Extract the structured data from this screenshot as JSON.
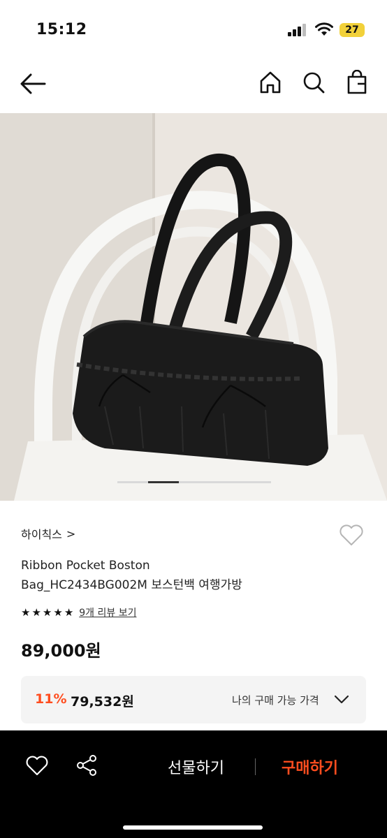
{
  "status_bar": {
    "time": "15:12",
    "battery": "27"
  },
  "nav": {
    "icons": [
      "back-arrow-icon",
      "home-icon",
      "search-icon",
      "shopping-bag-icon"
    ]
  },
  "product": {
    "brand": "하이칙스",
    "brand_chevron": ">",
    "title_line1": "Ribbon Pocket Boston",
    "title_line2": "Bag_HC2434BG002M 보스턴백 여행가방",
    "rating_stars": 5,
    "review_link": "9개 리뷰 보기",
    "price": "89,000원"
  },
  "discount": {
    "rate": "11%",
    "price": "79,532원",
    "label": "나의 구매 가능 가격"
  },
  "bottom_bar": {
    "gift_label": "선물하기",
    "buy_label": "구매하기"
  },
  "colors": {
    "accent": "#ff4d1f",
    "battery": "#f2d13a",
    "bottom_bar": "#000000"
  }
}
